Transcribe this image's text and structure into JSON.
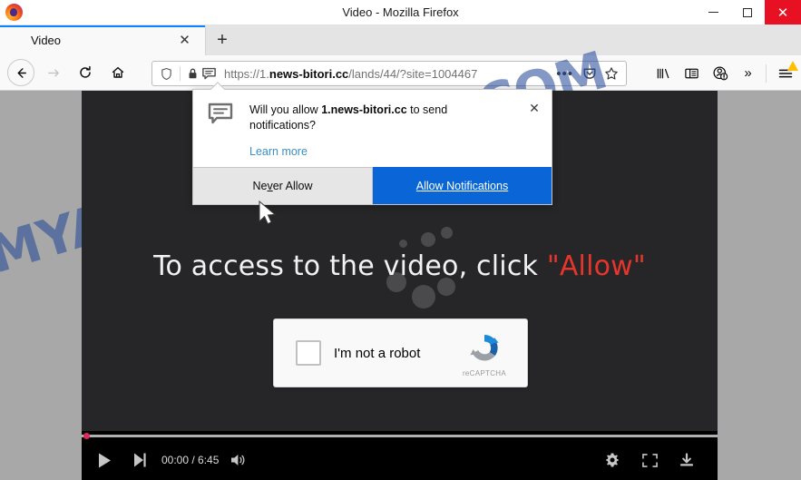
{
  "window": {
    "title": "Video - Mozilla Firefox",
    "logo_icon": "firefox-logo",
    "minimize_label": "—",
    "maximize_label": "□",
    "close_label": "✕"
  },
  "tabs": {
    "items": [
      {
        "label": "Video",
        "close_label": "✕",
        "active": true
      }
    ],
    "new_tab_label": "+"
  },
  "nav": {
    "back_icon": "back-arrow-icon",
    "forward_icon": "forward-arrow-icon",
    "reload_icon": "reload-icon",
    "home_icon": "home-icon"
  },
  "urlbar": {
    "shield_icon": "shield-icon",
    "lock_icon": "padlock-icon",
    "permission_icon": "notification-permission-icon",
    "url_prefix": "https://1.",
    "url_host": "news-bitori.cc",
    "url_path": "/lands/44/?site=1004467",
    "full_url": "https://1.news-bitori.cc/lands/44/?site=1004467",
    "page_actions_label": "•••",
    "pocket_icon": "pocket-icon",
    "bookmark_icon": "star-icon"
  },
  "toolbar_right": {
    "library_icon": "library-icon",
    "sidebar_icon": "sidebar-icon",
    "account_icon": "account-warning-icon",
    "overflow_label": "»",
    "menu_icon": "hamburger-menu-icon",
    "menu_badge_icon": "warning-triangle-icon"
  },
  "doorhanger": {
    "icon": "notification-bubble-icon",
    "message_prefix": "Will you allow ",
    "message_host": "1.news-bitori.cc",
    "message_suffix": " to send notifications?",
    "learn_more_label": "Learn more",
    "close_label": "✕",
    "never_allow_before": "Ne",
    "never_allow_key": "v",
    "never_allow_after": "er Allow",
    "allow_label": "Allow Notifications"
  },
  "page": {
    "watermark": "MYANTISPYWARE.COM",
    "watermark_color": "#1e4496",
    "headline_text": "To access to the video, click ",
    "headline_accent": "\"Allow\"",
    "headline_accent_color": "#e8352c",
    "cursor_icon": "mouse-pointer-icon"
  },
  "recaptcha": {
    "checkbox_name": "im-not-a-robot-checkbox",
    "label": "I'm not a robot",
    "brand": "reCAPTCHA",
    "logo_icon": "recaptcha-logo-icon"
  },
  "player": {
    "play_icon": "play-icon",
    "next_icon": "next-track-icon",
    "time_current": "00:00",
    "time_separator": " / ",
    "time_total": "6:45",
    "time_display": "00:00 / 6:45",
    "volume_icon": "volume-icon",
    "settings_icon": "gear-icon",
    "fullscreen_icon": "fullscreen-icon",
    "download_icon": "download-icon",
    "progress_percent": 0
  }
}
